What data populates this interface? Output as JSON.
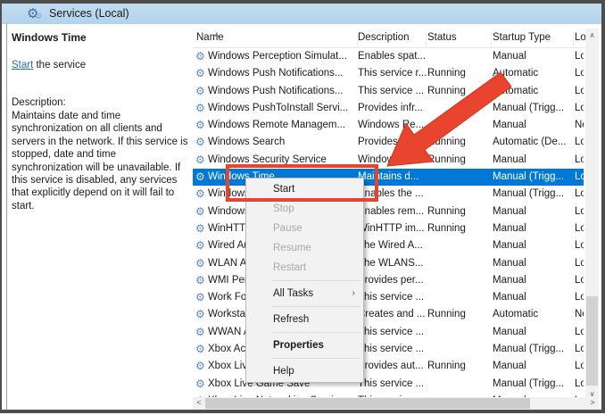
{
  "window": {
    "title": "Services (Local)"
  },
  "colors": {
    "annotation_red": "#e8442e",
    "selection_blue": "#0078d7",
    "band_blue": "#b8d6ee"
  },
  "icons": {
    "services_icon": "⚙",
    "service_gear_icon": "⚙",
    "sort_asc": "∧",
    "scroll_up": "∧",
    "scroll_down": "∨",
    "scroll_left": "<",
    "scroll_right": ">",
    "submenu_arrow": "›"
  },
  "sidebar": {
    "service_name": "Windows Time",
    "action_link": "Start",
    "action_suffix": " the service",
    "description_label": "Description:",
    "description": "Maintains date and time synchronization on all clients and servers in the network. If this service is stopped, date and time synchronization will be unavailable. If this service is disabled, any services that explicitly depend on it will fail to start."
  },
  "list": {
    "columns": [
      "Name",
      "Description",
      "Status",
      "Startup Type",
      "Log"
    ],
    "rows": [
      {
        "name": "Windows Perception Simulat...",
        "desc": "Enables spat...",
        "status": "",
        "startup": "Manual",
        "log": "Loc",
        "selected": false
      },
      {
        "name": "Windows Push Notifications...",
        "desc": "This service r...",
        "status": "Running",
        "startup": "Automatic",
        "log": "Loc",
        "selected": false
      },
      {
        "name": "Windows Push Notifications...",
        "desc": "This service ...",
        "status": "Running",
        "startup": "Automatic",
        "log": "Loc",
        "selected": false
      },
      {
        "name": "Windows PushToInstall Servi...",
        "desc": "Provides infr...",
        "status": "",
        "startup": "Manual (Trigg...",
        "log": "Loc",
        "selected": false
      },
      {
        "name": "Windows Remote Managem...",
        "desc": "Windows Re...",
        "status": "",
        "startup": "Manual",
        "log": "Ne",
        "selected": false
      },
      {
        "name": "Windows Search",
        "desc": "Provides co...",
        "status": "Running",
        "startup": "Automatic (De...",
        "log": "Loc",
        "selected": false
      },
      {
        "name": "Windows Security Service",
        "desc": "Windows Se...",
        "status": "Running",
        "startup": "Manual",
        "log": "Loc",
        "selected": false
      },
      {
        "name": "Windows Time",
        "desc": "Maintains d...",
        "status": "",
        "startup": "Manual (Trigg...",
        "log": "Loc",
        "selected": true
      },
      {
        "name": "Windows Update",
        "desc": "Enables the ...",
        "status": "",
        "startup": "Manual (Trigg...",
        "log": "Loc",
        "selected": false
      },
      {
        "name": "Windows Update Medic Serv...",
        "desc": "Enables rem...",
        "status": "Running",
        "startup": "Manual",
        "log": "Loc",
        "selected": false
      },
      {
        "name": "WinHTTP Web Proxy Auto-D...",
        "desc": "WinHTTP im...",
        "status": "Running",
        "startup": "Manual",
        "log": "Loc",
        "selected": false
      },
      {
        "name": "Wired AutoConfig",
        "desc": "The Wired A...",
        "status": "",
        "startup": "Manual",
        "log": "Loc",
        "selected": false
      },
      {
        "name": "WLAN AutoConfig",
        "desc": "The WLANS...",
        "status": "",
        "startup": "Manual",
        "log": "Loc",
        "selected": false
      },
      {
        "name": "WMI Performance Adapter",
        "desc": "Provides per...",
        "status": "",
        "startup": "Manual",
        "log": "Loc",
        "selected": false
      },
      {
        "name": "Work Folders",
        "desc": "This service ...",
        "status": "",
        "startup": "Manual",
        "log": "Loc",
        "selected": false
      },
      {
        "name": "Workstation",
        "desc": "Creates and ...",
        "status": "Running",
        "startup": "Automatic",
        "log": "Ne",
        "selected": false
      },
      {
        "name": "WWAN AutoConfig",
        "desc": "This service ...",
        "status": "",
        "startup": "Manual",
        "log": "Loc",
        "selected": false
      },
      {
        "name": "Xbox Accessory Manageme...",
        "desc": "This service ...",
        "status": "",
        "startup": "Manual (Trigg...",
        "log": "Loc",
        "selected": false
      },
      {
        "name": "Xbox Live Auth Manager",
        "desc": "Provides aut...",
        "status": "Running",
        "startup": "Manual",
        "log": "Loc",
        "selected": false
      },
      {
        "name": "Xbox Live Game Save",
        "desc": "This service ...",
        "status": "",
        "startup": "Manual (Trigg...",
        "log": "Loc",
        "selected": false
      },
      {
        "name": "Xbox Live Networking Service",
        "desc": "This service ...",
        "status": "",
        "startup": "Manual",
        "log": "Loc",
        "selected": false
      }
    ]
  },
  "context_menu": {
    "items": [
      {
        "label": "Start",
        "enabled": true
      },
      {
        "label": "Stop",
        "enabled": false
      },
      {
        "label": "Pause",
        "enabled": false
      },
      {
        "label": "Resume",
        "enabled": false
      },
      {
        "label": "Restart",
        "enabled": false
      },
      {
        "separator": true
      },
      {
        "label": "All Tasks",
        "enabled": true,
        "submenu": true
      },
      {
        "separator": true
      },
      {
        "label": "Refresh",
        "enabled": true
      },
      {
        "separator": true
      },
      {
        "label": "Properties",
        "enabled": true,
        "bold": true
      },
      {
        "separator": true
      },
      {
        "label": "Help",
        "enabled": true
      }
    ]
  }
}
